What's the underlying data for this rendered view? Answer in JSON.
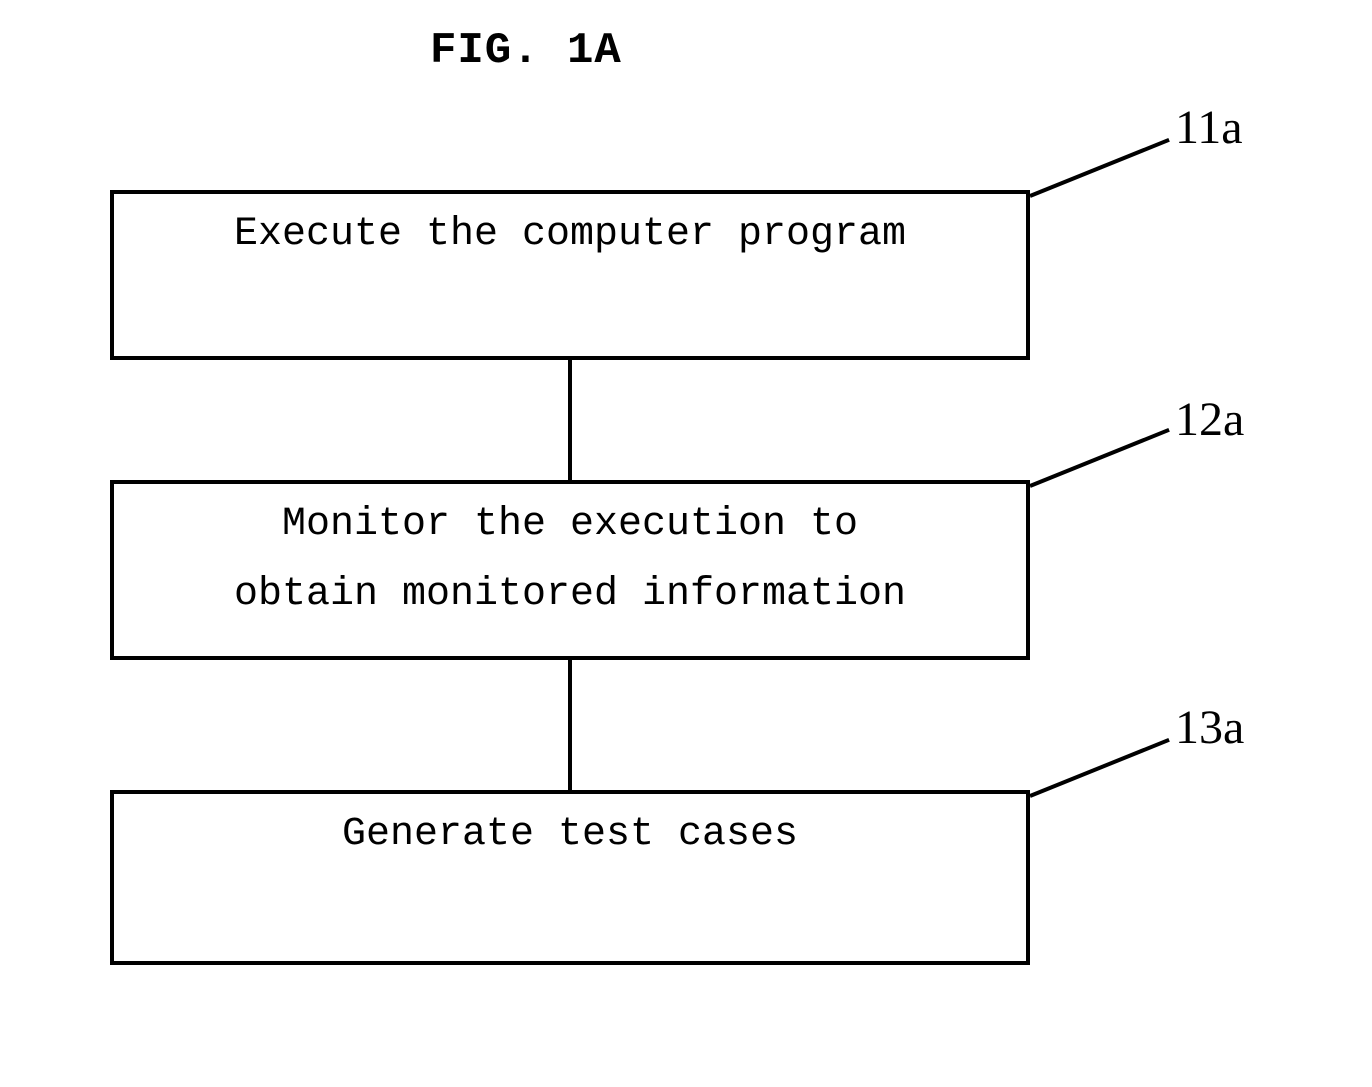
{
  "figure": {
    "title": "FIG. 1A"
  },
  "boxes": {
    "b11a": {
      "text": "Execute the computer program",
      "ref": "11a"
    },
    "b12a": {
      "line1": "Monitor the execution to",
      "line2": "obtain monitored information",
      "ref": "12a"
    },
    "b13a": {
      "text": "Generate test cases",
      "ref": "13a"
    }
  }
}
